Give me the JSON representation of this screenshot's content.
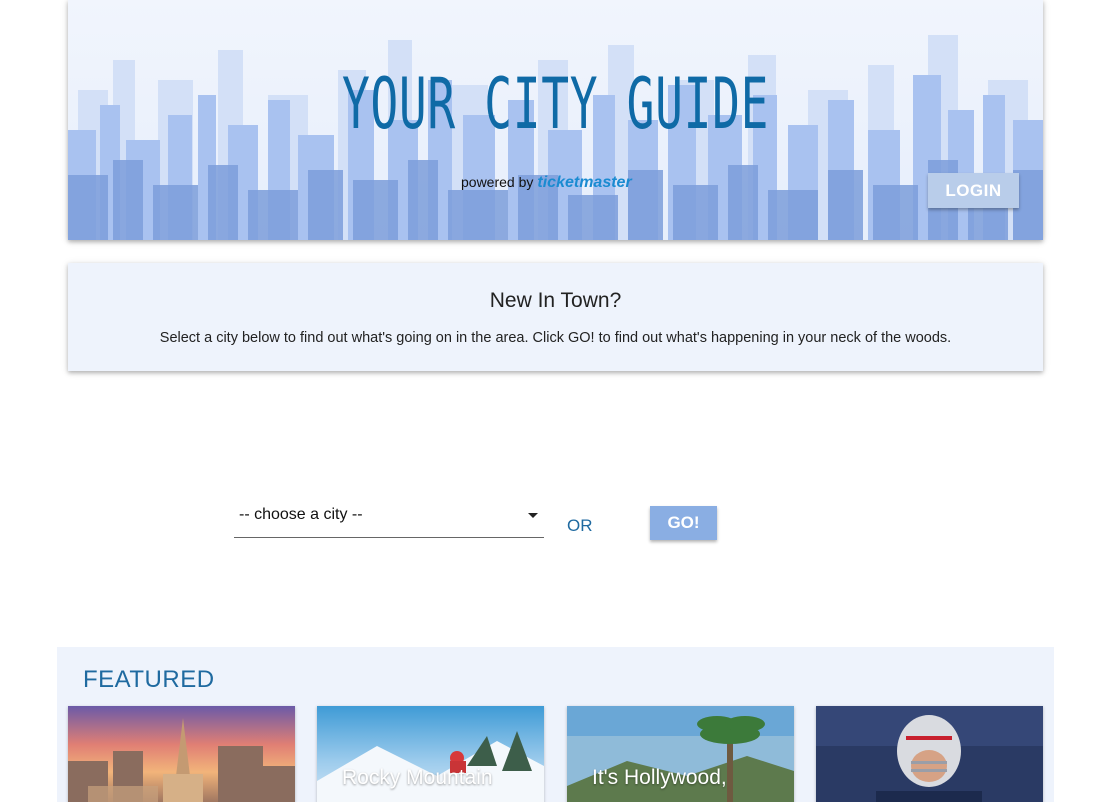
{
  "header": {
    "title": "YOUR CITY GUIDE",
    "powered_by": "powered by",
    "brand": "ticketmaster",
    "login_label": "LOGIN"
  },
  "intro": {
    "heading": "New In Town?",
    "text": "Select a city below to find out what's going on in the area. Click GO! to find out what's happening in your neck of the woods."
  },
  "search": {
    "city_select_value": "-- choose a city --",
    "or_label": "OR",
    "go_label": "GO!"
  },
  "featured": {
    "heading": "FEATURED",
    "cards": [
      {
        "caption": ""
      },
      {
        "caption": "Rocky Mountain"
      },
      {
        "caption": "It's Hollywood,"
      },
      {
        "caption": ""
      }
    ]
  },
  "colors": {
    "accent": "#1f6aa0",
    "panel_bg": "#eef3fc",
    "button": "#8aaee3"
  }
}
